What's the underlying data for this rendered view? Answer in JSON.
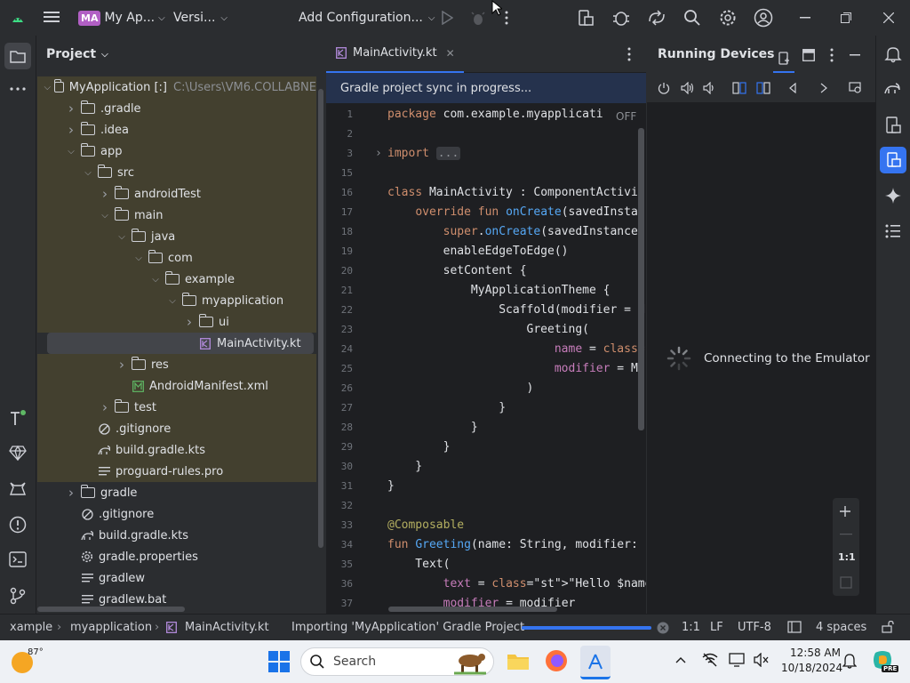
{
  "titlebar": {
    "project_badge": "MA",
    "project_name": "My Ap...",
    "vcs": "Versi...",
    "run_config": "Add Configuration..."
  },
  "project_panel": {
    "title": "Project",
    "tree": [
      {
        "label": "MyApplication [:]",
        "extra": "C:\\Users\\VM6.COLLABNE",
        "depth": 0,
        "expanded": true,
        "type": "module"
      },
      {
        "label": ".gradle",
        "depth": 1,
        "expanded": false,
        "type": "folder"
      },
      {
        "label": ".idea",
        "depth": 1,
        "expanded": false,
        "type": "folder"
      },
      {
        "label": "app",
        "depth": 1,
        "expanded": true,
        "type": "folder"
      },
      {
        "label": "src",
        "depth": 2,
        "expanded": true,
        "type": "folder"
      },
      {
        "label": "androidTest",
        "depth": 3,
        "expanded": false,
        "type": "folder"
      },
      {
        "label": "main",
        "depth": 3,
        "expanded": true,
        "type": "folder"
      },
      {
        "label": "java",
        "depth": 4,
        "expanded": true,
        "type": "folder"
      },
      {
        "label": "com",
        "depth": 5,
        "expanded": true,
        "type": "folder"
      },
      {
        "label": "example",
        "depth": 6,
        "expanded": true,
        "type": "folder"
      },
      {
        "label": "myapplication",
        "depth": 7,
        "expanded": true,
        "type": "folder"
      },
      {
        "label": "ui",
        "depth": 8,
        "expanded": false,
        "type": "folder"
      },
      {
        "label": "MainActivity.kt",
        "depth": 8,
        "type": "kotlin",
        "selected": true
      },
      {
        "label": "res",
        "depth": 4,
        "expanded": false,
        "type": "folder"
      },
      {
        "label": "AndroidManifest.xml",
        "depth": 4,
        "type": "manifest"
      },
      {
        "label": "test",
        "depth": 3,
        "expanded": false,
        "type": "folder"
      },
      {
        "label": ".gitignore",
        "depth": 2,
        "type": "ignore"
      },
      {
        "label": "build.gradle.kts",
        "depth": 2,
        "type": "gradle"
      },
      {
        "label": "proguard-rules.pro",
        "depth": 2,
        "type": "text"
      },
      {
        "label": "gradle",
        "depth": 1,
        "expanded": false,
        "type": "folder",
        "plain": true
      },
      {
        "label": ".gitignore",
        "depth": 1,
        "type": "ignore",
        "plain": true
      },
      {
        "label": "build.gradle.kts",
        "depth": 1,
        "type": "gradle",
        "plain": true
      },
      {
        "label": "gradle.properties",
        "depth": 1,
        "type": "settings",
        "plain": true
      },
      {
        "label": "gradlew",
        "depth": 1,
        "type": "text",
        "plain": true
      },
      {
        "label": "gradlew.bat",
        "depth": 1,
        "type": "text",
        "plain": true
      }
    ]
  },
  "editor": {
    "tab_label": "MainActivity.kt",
    "sync_message": "Gradle project sync in progress...",
    "off_badge": "OFF",
    "lines": [
      {
        "n": "1",
        "t": "package com.example.myapplicati"
      },
      {
        "n": "2",
        "t": ""
      },
      {
        "n": "3",
        "t": "import ..."
      },
      {
        "n": "15",
        "t": ""
      },
      {
        "n": "16",
        "t": "class MainActivity : ComponentActivit"
      },
      {
        "n": "17",
        "t": "    override fun onCreate(savedInstan"
      },
      {
        "n": "18",
        "t": "        super.onCreate(savedInstanceS"
      },
      {
        "n": "19",
        "t": "        enableEdgeToEdge()"
      },
      {
        "n": "20",
        "t": "        setContent {"
      },
      {
        "n": "21",
        "t": "            MyApplicationTheme {"
      },
      {
        "n": "22",
        "t": "                Scaffold(modifier = M"
      },
      {
        "n": "23",
        "t": "                    Greeting("
      },
      {
        "n": "24",
        "t": "                        name = \"Andro"
      },
      {
        "n": "25",
        "t": "                        modifier = Mo"
      },
      {
        "n": "26",
        "t": "                    )"
      },
      {
        "n": "27",
        "t": "                }"
      },
      {
        "n": "28",
        "t": "            }"
      },
      {
        "n": "29",
        "t": "        }"
      },
      {
        "n": "30",
        "t": "    }"
      },
      {
        "n": "31",
        "t": "}"
      },
      {
        "n": "32",
        "t": ""
      },
      {
        "n": "33",
        "t": "@Composable"
      },
      {
        "n": "34",
        "t": "fun Greeting(name: String, modifier: "
      },
      {
        "n": "35",
        "t": "    Text("
      },
      {
        "n": "36",
        "t": "        text = \"Hello $name!\","
      },
      {
        "n": "37",
        "t": "        modifier = modifier"
      }
    ]
  },
  "running_devices": {
    "title": "Running Devices",
    "connecting": "Connecting to the Emulator",
    "zoom_reset": "1:1"
  },
  "statusbar": {
    "crumbs": [
      "xample",
      "myapplication",
      "MainActivity.kt"
    ],
    "task": "Importing 'MyApplication' Gradle Project",
    "progress": 1.0,
    "position": "1:1",
    "line_sep": "LF",
    "encoding": "UTF-8",
    "indent": "4 spaces"
  },
  "taskbar": {
    "weather": "87°",
    "search_label": "Search",
    "time": "12:58 AM",
    "date": "10/18/2024",
    "copilot_badge": "PRE"
  }
}
